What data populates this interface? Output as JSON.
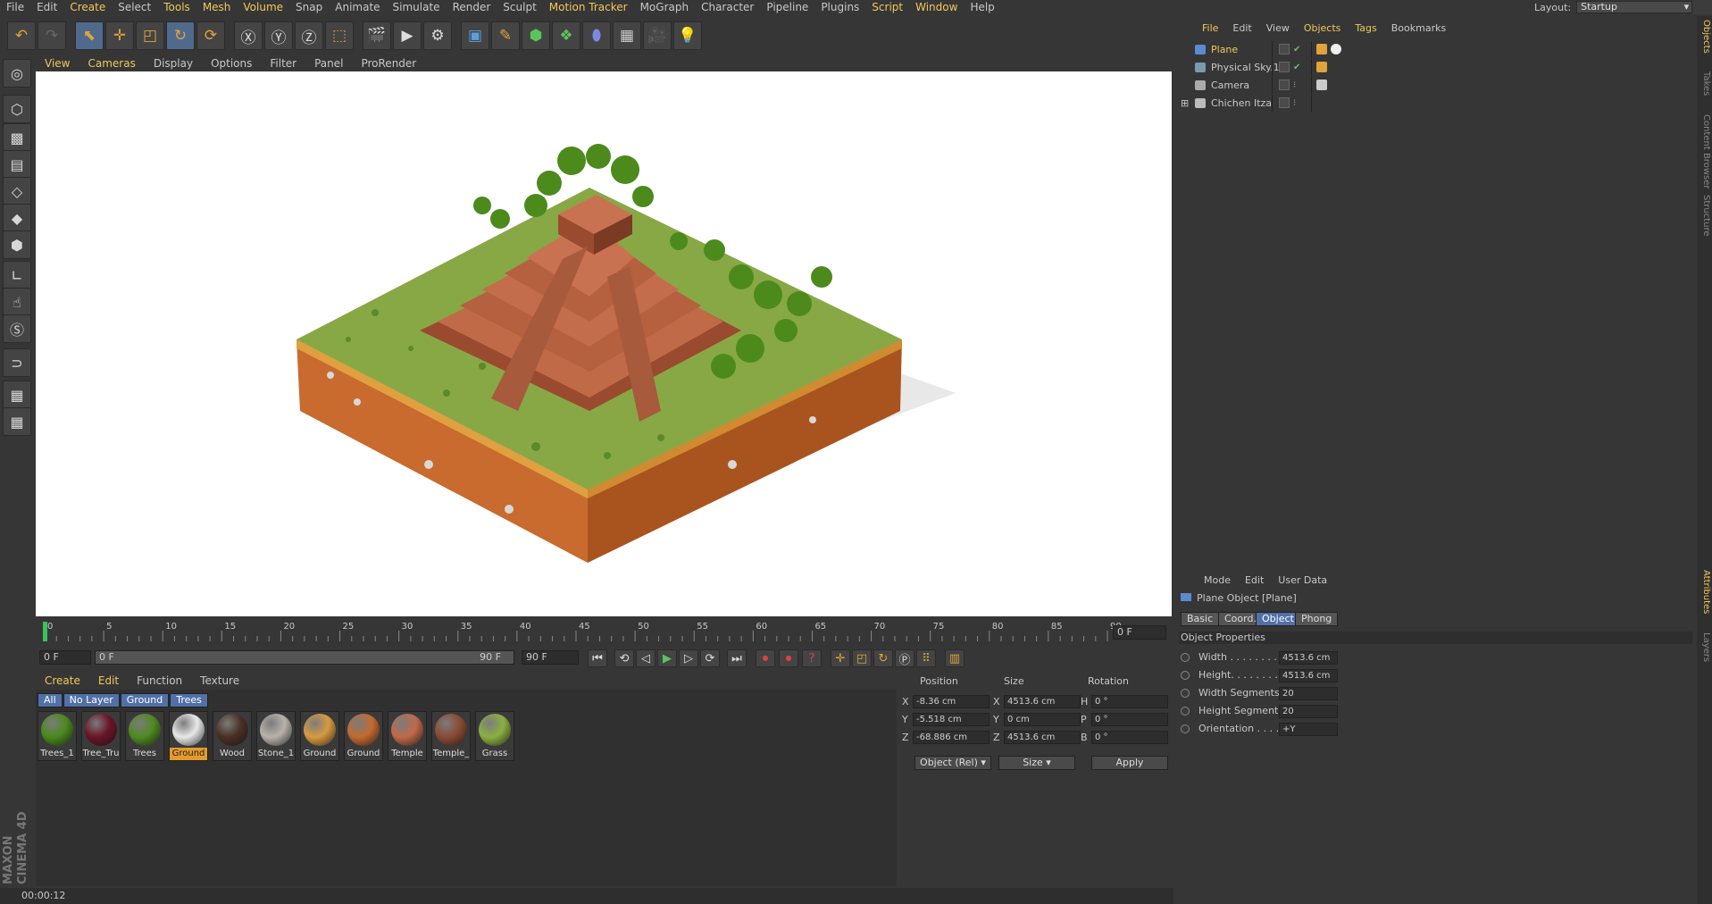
{
  "menubar": {
    "items": [
      "File",
      "Edit",
      "Create",
      "Select",
      "Tools",
      "Mesh",
      "Volume",
      "Snap",
      "Animate",
      "Simulate",
      "Render",
      "Sculpt",
      "Motion Tracker",
      "MoGraph",
      "Character",
      "Pipeline",
      "Plugins",
      "Script",
      "Window",
      "Help"
    ],
    "highlighted": [
      "Create",
      "Tools",
      "Mesh",
      "Volume",
      "Motion Tracker",
      "Script",
      "Window"
    ],
    "layout_label": "Layout:",
    "layout_value": "Startup"
  },
  "viewport_menu": {
    "items": [
      "View",
      "Cameras",
      "Display",
      "Options",
      "Filter",
      "Panel",
      "ProRender"
    ],
    "highlighted": [
      "View",
      "Cameras"
    ]
  },
  "timeline": {
    "ticks": [
      "0",
      "5",
      "10",
      "15",
      "20",
      "25",
      "30",
      "35",
      "40",
      "45",
      "50",
      "55",
      "60",
      "65",
      "70",
      "75",
      "80",
      "85",
      "90"
    ],
    "current_frame": "0 F"
  },
  "playbar": {
    "start_field": "0 F",
    "range_start": "0 F",
    "range_end": "90 F",
    "end_field": "90 F"
  },
  "material_manager": {
    "menu": [
      "Create",
      "Edit",
      "Function",
      "Texture"
    ],
    "filters": [
      "All",
      "No Layer",
      "Ground",
      "Trees"
    ],
    "materials": [
      {
        "label": "Trees_1",
        "color": "#4a8a1c"
      },
      {
        "label": "Tree_Tru",
        "color": "#6a1426"
      },
      {
        "label": "Trees",
        "color": "#4e8a20"
      },
      {
        "label": "Ground",
        "color": "#e8e8e8",
        "selected": true
      },
      {
        "label": "Wood",
        "color": "#4a3024"
      },
      {
        "label": "Stone_1",
        "color": "#b8b2aa"
      },
      {
        "label": "Ground",
        "color": "#d89a40"
      },
      {
        "label": "Ground",
        "color": "#c46a30"
      },
      {
        "label": "Temple",
        "color": "#c06a48"
      },
      {
        "label": "Temple_",
        "color": "#8a4a34"
      },
      {
        "label": "Grass",
        "color": "#8ab040"
      }
    ]
  },
  "coordinates": {
    "headers": {
      "position": "Position",
      "size": "Size",
      "rotation": "Rotation"
    },
    "rows": [
      {
        "axis": "X",
        "pos": "-8.36 cm",
        "size_axis": "X",
        "size": "4513.6 cm",
        "rot_axis": "H",
        "rot": "0 °"
      },
      {
        "axis": "Y",
        "pos": "-5.518 cm",
        "size_axis": "Y",
        "size": "0 cm",
        "rot_axis": "P",
        "rot": "0 °"
      },
      {
        "axis": "Z",
        "pos": "-68.886 cm",
        "size_axis": "Z",
        "size": "4513.6 cm",
        "rot_axis": "B",
        "rot": "0 °"
      }
    ],
    "mode_select": "Object (Rel)",
    "size_select": "Size",
    "apply_label": "Apply"
  },
  "status": {
    "time": "00:00:12"
  },
  "object_manager": {
    "menu": [
      "File",
      "Edit",
      "View",
      "Objects",
      "Tags",
      "Bookmarks"
    ],
    "highlighted": [
      "File",
      "Objects",
      "Tags"
    ],
    "objects": [
      {
        "name": "Plane",
        "color": "#5a8ad0",
        "highlight": true
      },
      {
        "name": "Physical Sky.1",
        "color": "#7a9ab0"
      },
      {
        "name": "Camera",
        "color": "#aaaaaa"
      },
      {
        "name": "Chichen Itza",
        "color": "#bbbbbb"
      }
    ]
  },
  "attribute_manager": {
    "menu": [
      "Mode",
      "Edit",
      "User Data"
    ],
    "title": "Plane Object [Plane]",
    "tabs": [
      "Basic",
      "Coord.",
      "Object",
      "Phong"
    ],
    "selected_tab": "Object",
    "section": "Object Properties",
    "props": [
      {
        "label": "Width . . . . . . . . .",
        "value": "4513.6 cm"
      },
      {
        "label": "Height. . . . . . . . .",
        "value": "4513.6 cm"
      },
      {
        "label": "Width Segments",
        "value": "20"
      },
      {
        "label": "Height Segments",
        "value": "20"
      },
      {
        "label": "Orientation . . . .",
        "value": "+Y"
      }
    ]
  },
  "side_tabs": [
    "Objects",
    "Takes",
    "Content Browser",
    "Structure",
    "Attributes",
    "Layers"
  ],
  "branding": "MAXON CINEMA 4D",
  "colors": {
    "accent": "#f0c85a",
    "selection": "#5170a8",
    "material_selected": "#e59a2e"
  }
}
